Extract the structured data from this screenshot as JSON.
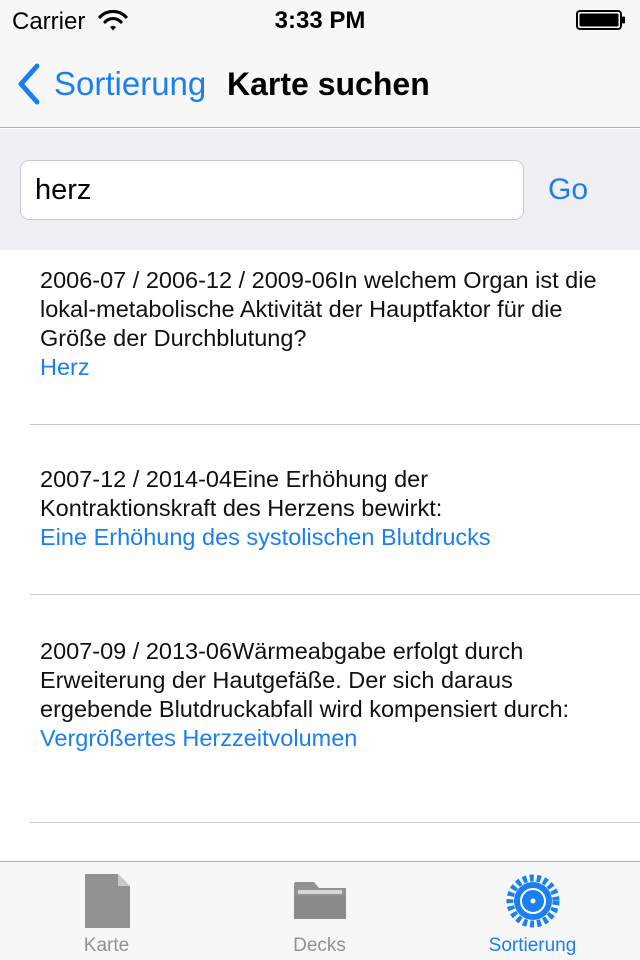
{
  "status_bar": {
    "carrier": "Carrier",
    "time": "3:33 PM",
    "icons": [
      "wifi-icon",
      "battery-icon"
    ]
  },
  "nav": {
    "back_label": "Sortierung",
    "title": "Karte suchen"
  },
  "search": {
    "value": "herz",
    "go_label": "Go"
  },
  "results": [
    {
      "question": "2006-07 / 2006-12 / 2009-06In welchem Organ ist die lokal-metabolische Aktivität der Hauptfaktor für die Größe der Durchblutung?",
      "answer": "Herz"
    },
    {
      "question": "2007-12 / 2014-04Eine Erhöhung der Kontraktionskraft des Herzens bewirkt:",
      "answer": "Eine Erhöhung des systolischen Blutdrucks"
    },
    {
      "question": "2007-09 / 2013-06Wärmeabgabe erfolgt durch Erweiterung der Hautgefäße. Der sich daraus ergebende Blutdruckabfall wird kompensiert durch:",
      "answer": "Vergrößertes Herzzeitvolumen"
    }
  ],
  "tabs": [
    {
      "label": "Karte",
      "icon": "card-icon"
    },
    {
      "label": "Decks",
      "icon": "folder-icon"
    },
    {
      "label": "Sortierung",
      "icon": "gear-icon",
      "active": true
    }
  ],
  "colors": {
    "accent": "#1a7ff0",
    "tab_inactive": "#929292",
    "bar_background": "#f7f7f7",
    "search_background": "#efeff4"
  }
}
